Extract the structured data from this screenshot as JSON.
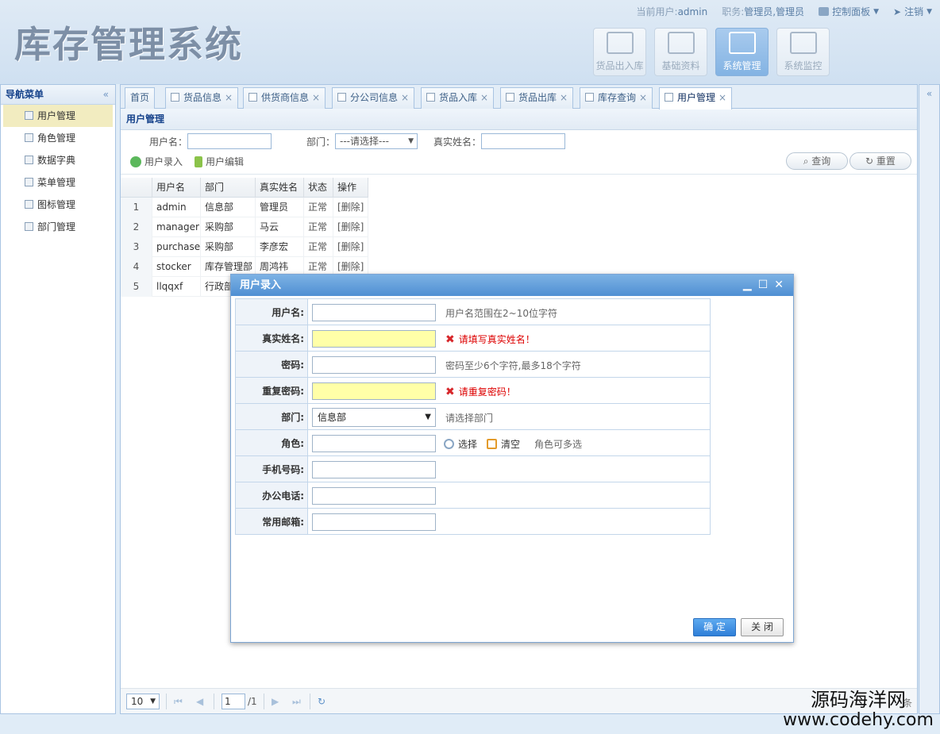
{
  "header": {
    "logo": "库存管理系统",
    "current_user_label": "当前用户:",
    "current_user": "admin",
    "role_label": "职务:",
    "role": "管理员,管理员",
    "control_panel": "控制面板",
    "logout": "注销",
    "modules": [
      {
        "label": "货品出入库",
        "icon": "edit-icon"
      },
      {
        "label": "基础资料",
        "icon": "edit-icon"
      },
      {
        "label": "系统管理",
        "icon": "settings-icon"
      },
      {
        "label": "系统监控",
        "icon": "monitor-icon"
      }
    ]
  },
  "leftnav": {
    "title": "导航菜单",
    "collapse": "«",
    "items": [
      "用户管理",
      "角色管理",
      "数据字典",
      "菜单管理",
      "图标管理",
      "部门管理"
    ]
  },
  "rightcol": {
    "expand": "«"
  },
  "tabs": [
    {
      "label": "首页",
      "closable": false
    },
    {
      "label": "货品信息",
      "closable": true
    },
    {
      "label": "供货商信息",
      "closable": true
    },
    {
      "label": "分公司信息",
      "closable": true
    },
    {
      "label": "货品入库",
      "closable": true
    },
    {
      "label": "货品出库",
      "closable": true
    },
    {
      "label": "库存查询",
      "closable": true
    },
    {
      "label": "用户管理",
      "closable": true
    }
  ],
  "tab_close": "×",
  "panel": {
    "title": "用户管理",
    "search": {
      "username_label": "用户名：",
      "dept_label": "部门：",
      "dept_value": "---请选择---",
      "realname_label": "真实姓名："
    },
    "toolbar": {
      "add": "用户录入",
      "edit": "用户编辑"
    },
    "query_btn": "查询",
    "reset_btn": "重置",
    "columns": [
      "用户名",
      "部门",
      "真实姓名",
      "状态",
      "操作"
    ],
    "rows": [
      {
        "no": "1",
        "username": "admin",
        "dept": "信息部",
        "realname": "管理员",
        "status": "正常",
        "op": "[删除]"
      },
      {
        "no": "2",
        "username": "manager",
        "dept": "采购部",
        "realname": "马云",
        "status": "正常",
        "op": "[删除]"
      },
      {
        "no": "3",
        "username": "purchaser",
        "dept": "采购部",
        "realname": "李彦宏",
        "status": "正常",
        "op": "[删除]"
      },
      {
        "no": "4",
        "username": "stocker",
        "dept": "库存管理部",
        "realname": "周鸿祎",
        "status": "正常",
        "op": "[删除]"
      },
      {
        "no": "5",
        "username": "llqqxf",
        "dept": "行政部",
        "realname": "",
        "status": "",
        "op": ""
      }
    ],
    "pager": {
      "page_size": "10",
      "page": "1",
      "total": "/1",
      "info": "条"
    }
  },
  "dialog": {
    "title": "用户录入",
    "fields": {
      "username": {
        "label": "用户名:",
        "hint": "用户名范围在2~10位字符"
      },
      "realname": {
        "label": "真实姓名:",
        "error": "请填写真实姓名！"
      },
      "password": {
        "label": "密码:",
        "hint": "密码至少6个字符,最多18个字符"
      },
      "repassword": {
        "label": "重复密码:",
        "error": "请重复密码！"
      },
      "dept": {
        "label": "部门:",
        "value": "信息部",
        "hint": "请选择部门"
      },
      "role": {
        "label": "角色:",
        "select": "选择",
        "clear": "清空",
        "hint": "角色可多选"
      },
      "mobile": {
        "label": "手机号码:"
      },
      "phone": {
        "label": "办公电话:"
      },
      "email": {
        "label": "常用邮箱:"
      }
    },
    "ok": "确 定",
    "cancel": "关 闭"
  },
  "watermark": {
    "line1": "源码海洋网",
    "line2": "www.codehy.com"
  }
}
